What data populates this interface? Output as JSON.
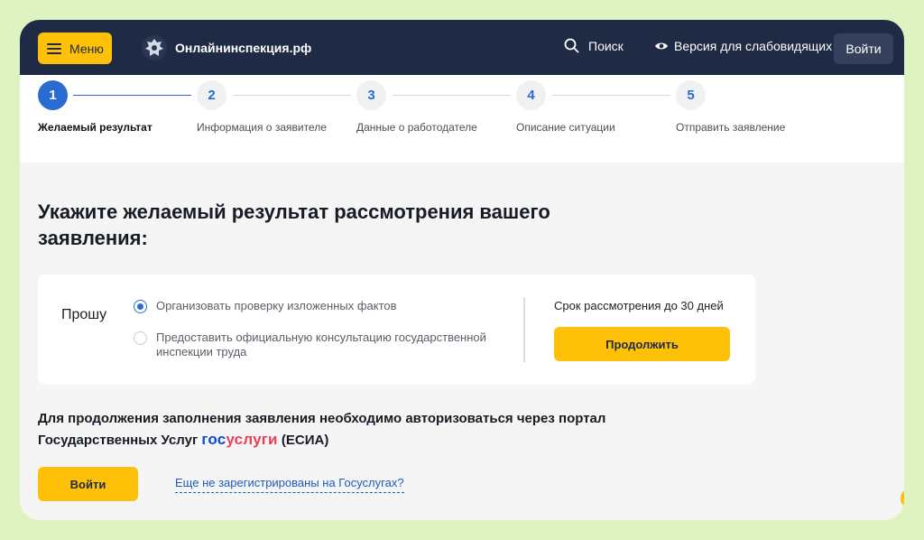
{
  "header": {
    "menu_label": "Меню",
    "site_name": "Онлайнинспекция.рф",
    "search_label": "Поиск",
    "vision_label": "Версия для слабовидящих",
    "login_label": "Войти"
  },
  "steps": [
    {
      "number": "1",
      "label": "Желаемый результат",
      "active": true
    },
    {
      "number": "2",
      "label": "Информация о заявителе",
      "active": false
    },
    {
      "number": "3",
      "label": "Данные о работодателе",
      "active": false
    },
    {
      "number": "4",
      "label": "Описание ситуации",
      "active": false
    },
    {
      "number": "5",
      "label": "Отправить заявление",
      "active": false
    }
  ],
  "main": {
    "heading": "Укажите желаемый результат рассмотрения вашего заявления:",
    "card": {
      "prefix": "Прошу",
      "options": [
        {
          "label": "Организовать проверку изложенных фактов",
          "checked": true
        },
        {
          "label": "Предоставить официальную консультацию государственной инспекции труда",
          "checked": false
        }
      ],
      "term": "Срок рассмотрения до 30 дней",
      "continue_label": "Продолжить"
    },
    "auth": {
      "text_before": "Для продолжения заполнения заявления необходимо авторизоваться через портал Государственных Услуг",
      "gos_part1": "гос",
      "gos_part2": "услуги",
      "text_after": "(ЕСИА)",
      "login_label": "Войти",
      "register_link": "Еще не зарегистрированы на Госуслугах?"
    }
  },
  "colors": {
    "accent": "#ffc107",
    "header_bg": "#1f2a44",
    "step_active": "#2a6bd1",
    "page_bg": "#f5f5f6",
    "frame_bg": "#dff3c0"
  }
}
